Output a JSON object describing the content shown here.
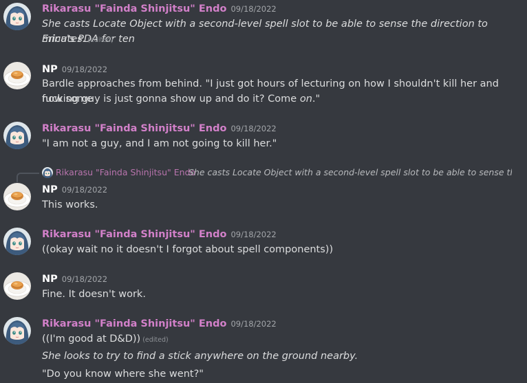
{
  "users": {
    "rika": "Rikarasu \"Fainda Shinjitsu\" Endo",
    "np": "NP"
  },
  "edited_label": "(edited)",
  "messages": [
    {
      "author": "Rikarasu \"Fainda Shinjitsu\" Endo",
      "timestamp": "09/18/2022",
      "line1": "She casts Locate Object with a second-level spell slot to be able to sense the direction to Erica's PDA for ten",
      "line2": "minutes."
    },
    {
      "author": "NP",
      "timestamp": "09/18/2022",
      "line1": "Bardle approaches from behind. \"I just got hours of lecturing on how I shouldn't kill her and now some",
      "line2_a": "fucking guy is just gonna show up and do it? Come ",
      "line2_em": "on",
      "line2_b": ".\""
    },
    {
      "author": "Rikarasu \"Fainda Shinjitsu\" Endo",
      "timestamp": "09/18/2022",
      "line1": "\"I am not a guy, and I am not going to kill her.\""
    },
    {
      "author": "NP",
      "timestamp": "09/18/2022",
      "line1": "This works."
    },
    {
      "author": "Rikarasu \"Fainda Shinjitsu\" Endo",
      "timestamp": "09/18/2022",
      "line1": "((okay wait no it doesn't I forgot about spell components))"
    },
    {
      "author": "NP",
      "timestamp": "09/18/2022",
      "line1": "Fine. It doesn't work."
    },
    {
      "author": "Rikarasu \"Fainda Shinjitsu\" Endo",
      "timestamp": "09/18/2022",
      "line1": "((I'm good at D&D))",
      "line2": "She looks to try to find a stick anywhere on the ground nearby.",
      "line3": "\"Do you know where she went?\""
    }
  ],
  "reply": {
    "author": "Rikarasu \"Fainda Shinjitsu\" Endo",
    "preview": "She casts Locate Object with a second-level spell slot to be able to sense the directio..."
  },
  "colors": {
    "background": "#36393f",
    "rika_name": "#d280c9",
    "text": "#dcddde",
    "timestamp": "#a3a6aa"
  },
  "icons": {
    "rika_avatar": "anime-girl-avatar",
    "np_avatar": "food-plate-avatar"
  }
}
